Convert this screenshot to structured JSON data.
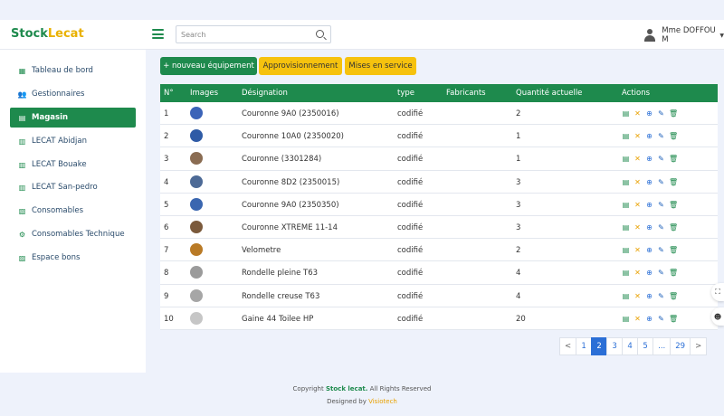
{
  "brand": {
    "part1": "Stock",
    "part2": "Lecat"
  },
  "search": {
    "placeholder": "Search"
  },
  "user": {
    "name": "Mme DOFFOU M"
  },
  "sidebar": {
    "items": [
      {
        "label": "Tableau de bord",
        "icon": "dashboard-icon",
        "glyph": "▦",
        "active": false
      },
      {
        "label": "Gestionnaires",
        "icon": "users-icon",
        "glyph": "👥",
        "active": false
      },
      {
        "label": "Magasin",
        "icon": "store-icon",
        "glyph": "▤",
        "active": true
      },
      {
        "label": "LECAT Abidjan",
        "icon": "building-icon",
        "glyph": "▥",
        "active": false
      },
      {
        "label": "LECAT Bouake",
        "icon": "building-icon",
        "glyph": "▥",
        "active": false
      },
      {
        "label": "LECAT San-pedro",
        "icon": "building-icon",
        "glyph": "▥",
        "active": false
      },
      {
        "label": "Consomables",
        "icon": "boxes-icon",
        "glyph": "▧",
        "active": false
      },
      {
        "label": "Consomables Technique",
        "icon": "gear-icon",
        "glyph": "⚙",
        "active": false
      },
      {
        "label": "Espace bons",
        "icon": "document-icon",
        "glyph": "▨",
        "active": false
      }
    ]
  },
  "toolbar": {
    "new_equipment": "+ nouveau équipement",
    "supply": "Approvisionnement",
    "commissioning": "Mises en service"
  },
  "table": {
    "headers": {
      "num": "N°",
      "images": "Images",
      "designation": "Désignation",
      "type": "type",
      "manufacturers": "Fabricants",
      "quantity": "Quantité actuelle",
      "actions": "Actions"
    },
    "rows": [
      {
        "num": "1",
        "designation": "Couronne 9A0 (2350016)",
        "type": "codifié",
        "manufacturer": "",
        "quantity": "2",
        "thumb": "#3b63b8"
      },
      {
        "num": "2",
        "designation": "Couronne 10A0 (2350020)",
        "type": "codifié",
        "manufacturer": "",
        "quantity": "1",
        "thumb": "#2f5ba6"
      },
      {
        "num": "3",
        "designation": "Couronne (3301284)",
        "type": "codifié",
        "manufacturer": "",
        "quantity": "1",
        "thumb": "#8a6c52"
      },
      {
        "num": "4",
        "designation": "Couronne 8D2 (2350015)",
        "type": "codifié",
        "manufacturer": "",
        "quantity": "3",
        "thumb": "#4d6a96"
      },
      {
        "num": "5",
        "designation": "Couronne 9A0 (2350350)",
        "type": "codifié",
        "manufacturer": "",
        "quantity": "3",
        "thumb": "#3a66b0"
      },
      {
        "num": "6",
        "designation": "Couronne XTREME 11-14",
        "type": "codifié",
        "manufacturer": "",
        "quantity": "3",
        "thumb": "#7b5a3c"
      },
      {
        "num": "7",
        "designation": "Velometre",
        "type": "codifié",
        "manufacturer": "",
        "quantity": "2",
        "thumb": "#b97a26"
      },
      {
        "num": "8",
        "designation": "Rondelle pleine T63",
        "type": "codifié",
        "manufacturer": "",
        "quantity": "4",
        "thumb": "#9b9b9b"
      },
      {
        "num": "9",
        "designation": "Rondelle creuse T63",
        "type": "codifié",
        "manufacturer": "",
        "quantity": "4",
        "thumb": "#a6a6a6"
      },
      {
        "num": "10",
        "designation": "Gaine 44 Toilee HP",
        "type": "codifié",
        "manufacturer": "",
        "quantity": "20",
        "thumb": "#c6c6c6"
      }
    ]
  },
  "actions": {
    "view": "▤",
    "delete": "✕",
    "add": "⊕",
    "edit": "✎",
    "trash": "🗑"
  },
  "pagination": {
    "prev": "<",
    "pages": [
      "1",
      "2",
      "3",
      "4",
      "5",
      "...",
      "29"
    ],
    "current": "2",
    "next": ">"
  },
  "footer": {
    "copyright_prefix": "Copyright ",
    "copyright_brand": "Stock lecat.",
    "copyright_suffix": " All Rights Reserved",
    "designed_prefix": "Designed by ",
    "designer": "Visiotech"
  },
  "colors": {
    "primary": "#1e8a4d",
    "accent": "#f6c20e",
    "link": "#2b6fd6"
  }
}
